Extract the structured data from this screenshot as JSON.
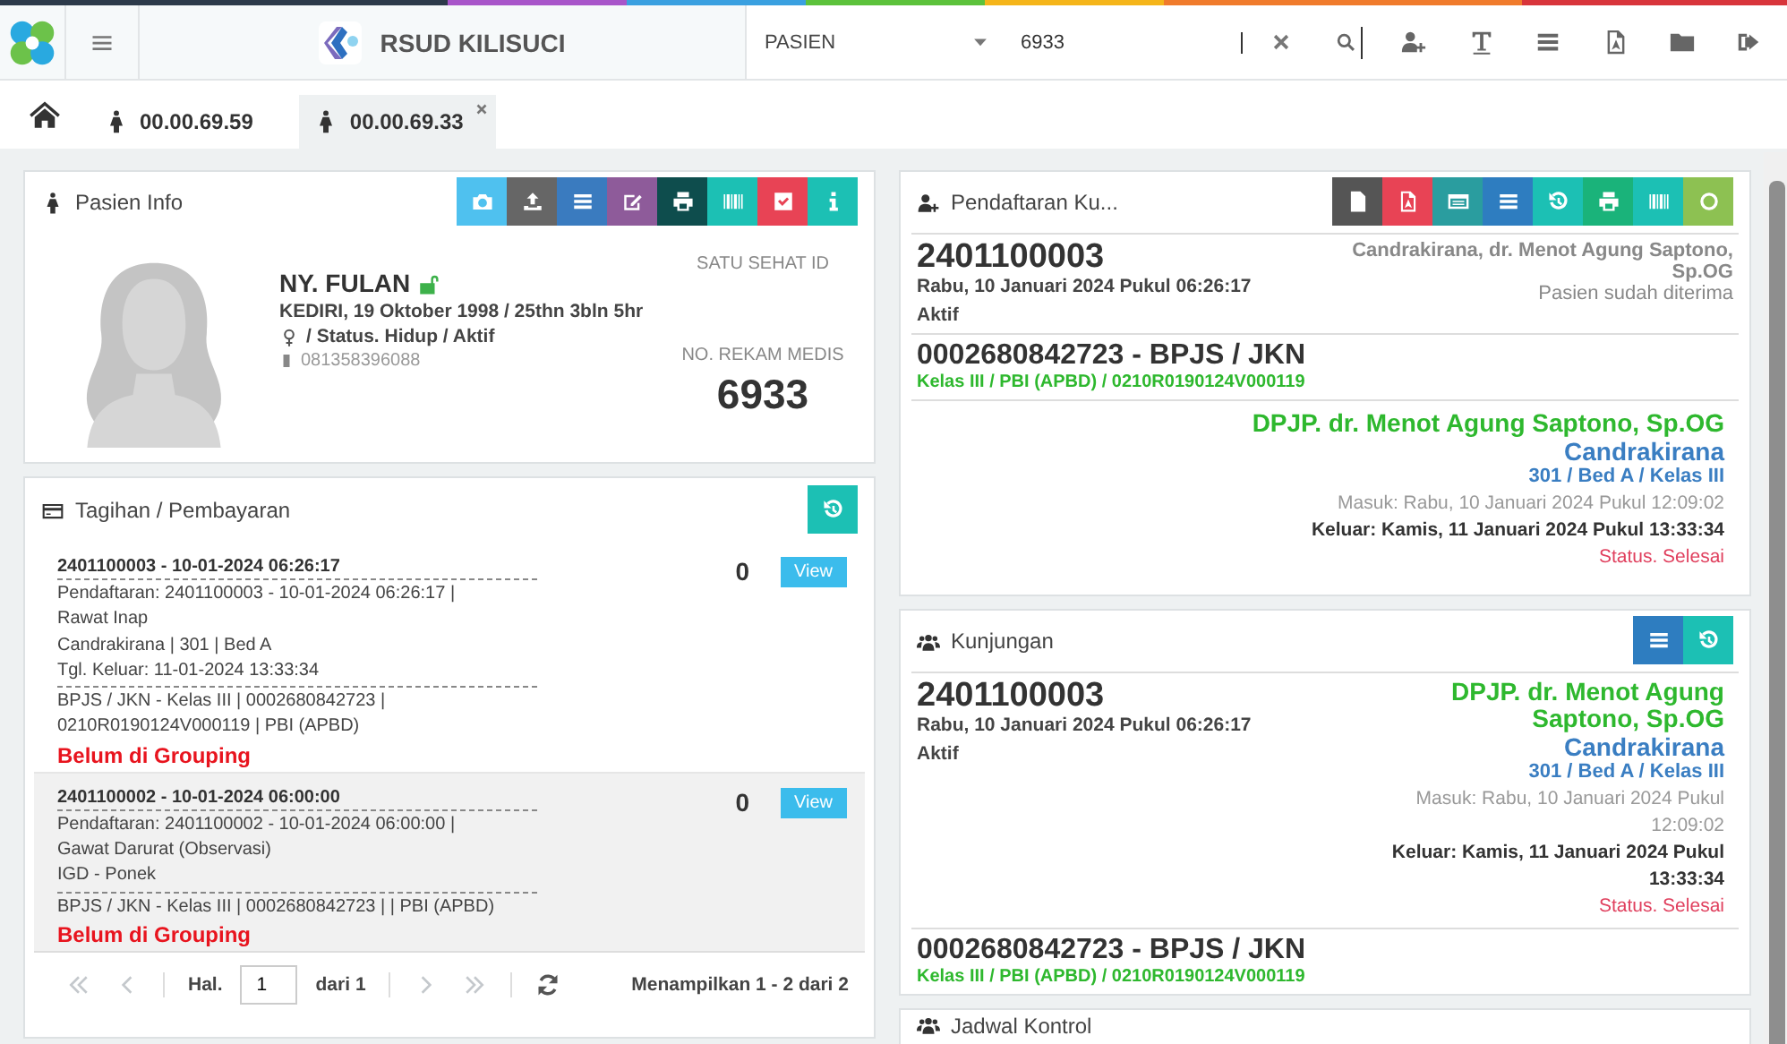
{
  "header": {
    "brand": "RSUD KILISUCI",
    "search_type": "PASIEN",
    "search_value": "6933"
  },
  "tabs": [
    {
      "label": "00.00.69.59",
      "selected": false,
      "closable": false
    },
    {
      "label": "00.00.69.33",
      "selected": true,
      "closable": true
    }
  ],
  "patient_info": {
    "title": "Pasien Info",
    "toolbar": [
      {
        "kind": "camera",
        "color": "#4fc1ef"
      },
      {
        "kind": "upload",
        "color": "#666666"
      },
      {
        "kind": "list",
        "color": "#3a7bbf"
      },
      {
        "kind": "edit",
        "color": "#8e5b9a"
      },
      {
        "kind": "print",
        "color": "#0e4d4d"
      },
      {
        "kind": "barcode",
        "color": "#1cc0b4"
      },
      {
        "kind": "check",
        "color": "#e84355"
      },
      {
        "kind": "info",
        "color": "#1cc0b4"
      }
    ],
    "name": "NY. FULAN",
    "unlocked": true,
    "birth": "KEDIRI, 19 Oktober 1998 / 25thn 3bln 5hr",
    "status": "/ Status. Hidup / Aktif",
    "phone": "081358396088",
    "satu_sehat_label": "SATU SEHAT ID",
    "mrn_label": "NO. REKAM MEDIS",
    "mrn": "6933"
  },
  "billing": {
    "title": "Tagihan / Pembayaran",
    "items": [
      {
        "header": "2401100003 - 10-01-2024 06:26:17",
        "blocks": [
          [
            "Pendaftaran: 2401100003 - 10-01-2024 06:26:17 |",
            "Rawat Inap",
            "Candrakirana | 301 | Bed A",
            "Tgl. Keluar: 11-01-2024 13:33:34"
          ],
          [
            "BPJS / JKN - Kelas III | 0002680842723 |",
            "0210R0190124V000119 | PBI (APBD)"
          ]
        ],
        "grouping": "Belum di Grouping",
        "amount": "0",
        "button": "View",
        "selected": false
      },
      {
        "header": "2401100002 - 10-01-2024 06:00:00",
        "blocks": [
          [
            "Pendaftaran: 2401100002 - 10-01-2024 06:00:00 |",
            "Gawat Darurat (Observasi)",
            "IGD - Ponek"
          ],
          [
            "BPJS / JKN - Kelas III | 0002680842723 | | PBI (APBD)"
          ]
        ],
        "grouping": "Belum di Grouping",
        "amount": "0",
        "button": "View",
        "selected": true
      }
    ],
    "pager": {
      "first_disabled": true,
      "prev_disabled": true,
      "page_label": "Hal.",
      "page": "1",
      "of": "dari 1",
      "next_disabled": true,
      "last_disabled": true,
      "summary": "Menampilkan 1 - 2 dari 2"
    }
  },
  "registration": {
    "title": "Pendaftaran Ku...",
    "toolbar": [
      {
        "kind": "file",
        "color": "#555555"
      },
      {
        "kind": "pdf",
        "color": "#e84355"
      },
      {
        "kind": "window",
        "color": "#2a9d9f"
      },
      {
        "kind": "list",
        "color": "#2e7dc0"
      },
      {
        "kind": "history",
        "color": "#1cc0b4"
      },
      {
        "kind": "print",
        "color": "#1ab37a"
      },
      {
        "kind": "barcode",
        "color": "#1cc0b4"
      },
      {
        "kind": "circle",
        "color": "#8dc152"
      }
    ],
    "number": "2401100003",
    "date": "Rabu, 10 Januari 2024 Pukul 06:26:17",
    "state": "Aktif",
    "unit_doctor": "Candrakirana, dr. Menot Agung Saptono, Sp.OG",
    "reception": "Pasien sudah diterima",
    "insurance": "0002680842723 - BPJS / JKN",
    "insurance_detail": "Kelas III / PBI (APBD) / 0210R0190124V000119",
    "dpjp": "DPJP. dr. Menot Agung Saptono, Sp.OG",
    "ward": "Candrakirana",
    "room": "301 / Bed A / Kelas III",
    "admitted": "Masuk: Rabu, 10 Januari 2024 Pukul 12:09:02",
    "discharged": "Keluar: Kamis, 11 Januari 2024 Pukul 13:33:34",
    "status": "Status. Selesai"
  },
  "visit": {
    "title": "Kunjungan",
    "toolbar": [
      {
        "kind": "list",
        "color": "#2e7dc0"
      },
      {
        "kind": "history",
        "color": "#1cc0b4"
      }
    ],
    "number": "2401100003",
    "date": "Rabu, 10 Januari 2024 Pukul 06:26:17",
    "state": "Aktif",
    "dpjp": "DPJP. dr. Menot Agung Saptono, Sp.OG",
    "ward": "Candrakirana",
    "room": "301 / Bed A / Kelas III",
    "admitted": "Masuk: Rabu, 10 Januari 2024 Pukul 12:09:02",
    "discharged": "Keluar: Kamis, 11 Januari 2024 Pukul 13:33:34",
    "status": "Status. Selesai",
    "insurance": "0002680842723 - BPJS / JKN",
    "insurance_detail": "Kelas III / PBI (APBD) / 0210R0190124V000119"
  },
  "schedule": {
    "title": "Jadwal Kontrol"
  }
}
